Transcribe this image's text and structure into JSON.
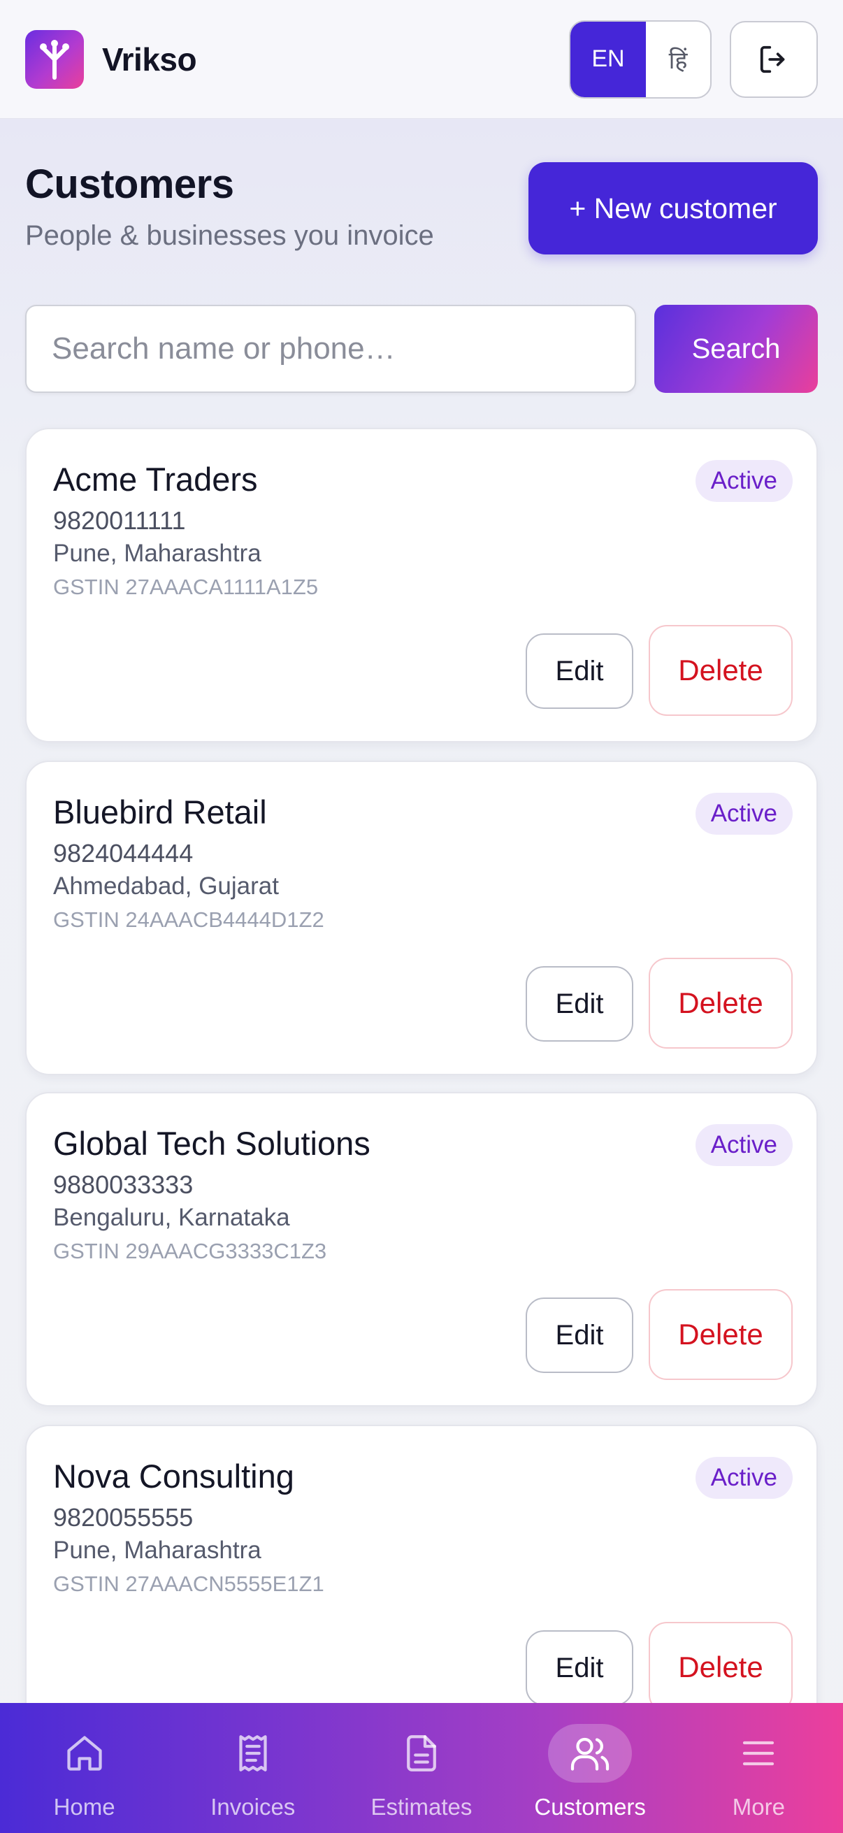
{
  "app": {
    "brand": "Vrikso",
    "lang_en": "EN",
    "lang_hi": "हिं"
  },
  "page": {
    "title": "Customers",
    "subtitle": "People & businesses you invoice",
    "new_button": "+ New customer"
  },
  "search": {
    "placeholder": "Search name or phone…",
    "value": "",
    "button": "Search"
  },
  "customers": [
    {
      "name": "Acme Traders",
      "phone": "9820011111",
      "location": "Pune, Maharashtra",
      "gstin": "GSTIN 27AAACA1111A1Z5",
      "status": "Active",
      "edit": "Edit",
      "delete": "Delete"
    },
    {
      "name": "Bluebird Retail",
      "phone": "9824044444",
      "location": "Ahmedabad, Gujarat",
      "gstin": "GSTIN 24AAACB4444D1Z2",
      "status": "Active",
      "edit": "Edit",
      "delete": "Delete"
    },
    {
      "name": "Global Tech Solutions",
      "phone": "9880033333",
      "location": "Bengaluru, Karnataka",
      "gstin": "GSTIN 29AAACG3333C1Z3",
      "status": "Active",
      "edit": "Edit",
      "delete": "Delete"
    },
    {
      "name": "Nova Consulting",
      "phone": "9820055555",
      "location": "Pune, Maharashtra",
      "gstin": "GSTIN 27AAACN5555E1Z1",
      "status": "Active",
      "edit": "Edit",
      "delete": "Delete"
    }
  ],
  "nav": [
    {
      "label": "Home",
      "icon": "home-icon",
      "active": false
    },
    {
      "label": "Invoices",
      "icon": "receipt-icon",
      "active": false
    },
    {
      "label": "Estimates",
      "icon": "document-icon",
      "active": false
    },
    {
      "label": "Customers",
      "icon": "users-icon",
      "active": true
    },
    {
      "label": "More",
      "icon": "menu-icon",
      "active": false
    }
  ],
  "colors": {
    "primary": "#4526d8",
    "gradient_start": "#4b2bd6",
    "gradient_end": "#ec3f9c",
    "active_badge_bg": "#efe9fb",
    "active_badge_text": "#6a1fc9",
    "delete_red": "#d4121f"
  }
}
